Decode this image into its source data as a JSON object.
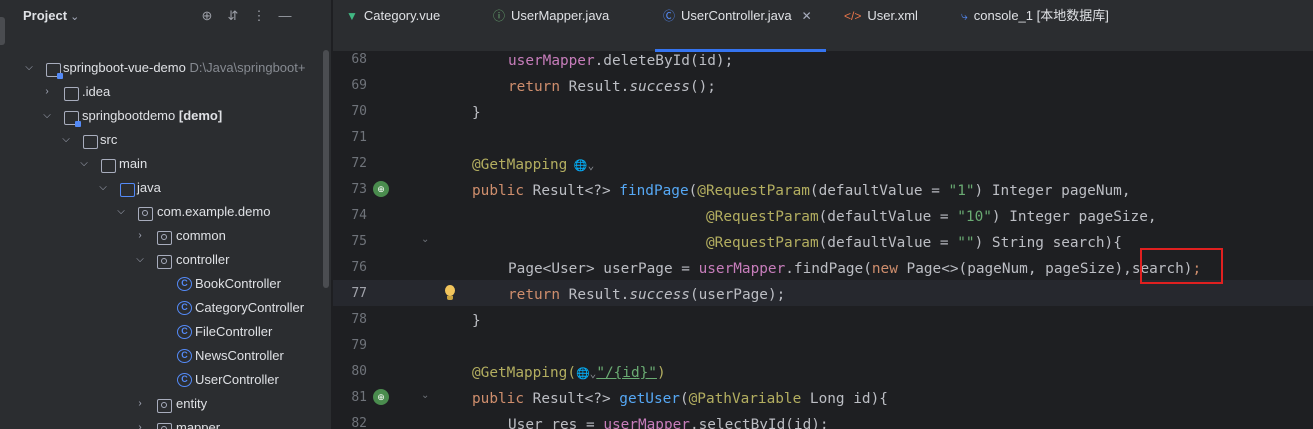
{
  "project_panel": {
    "title": "Project",
    "tree": [
      {
        "label": "springboot-vue-demo",
        "hint": "D:\\Java\\springboot+",
        "icon": "module-icon"
      },
      {
        "label": ".idea",
        "icon": "folder-icon"
      },
      {
        "label": "springbootdemo",
        "bold_suffix": "[demo]",
        "icon": "module-icon"
      },
      {
        "label": "src",
        "icon": "folder-icon"
      },
      {
        "label": "main",
        "icon": "folder-icon"
      },
      {
        "label": "java",
        "icon": "source-folder-icon"
      },
      {
        "label": "com.example.demo",
        "icon": "package-icon"
      },
      {
        "label": "common",
        "icon": "package-icon"
      },
      {
        "label": "controller",
        "icon": "package-icon"
      },
      {
        "label": "BookController",
        "icon": "class-icon"
      },
      {
        "label": "CategoryController",
        "icon": "class-icon"
      },
      {
        "label": "FileController",
        "icon": "class-icon"
      },
      {
        "label": "NewsController",
        "icon": "class-icon"
      },
      {
        "label": "UserController",
        "icon": "class-icon"
      },
      {
        "label": "entity",
        "icon": "package-icon"
      },
      {
        "label": "mapper",
        "icon": "package-icon"
      }
    ]
  },
  "tabs": [
    {
      "label": "Category.vue",
      "icon": "vue-icon"
    },
    {
      "label": "UserMapper.java",
      "icon": "interface-icon"
    },
    {
      "label": "UserController.java",
      "icon": "class-icon",
      "active": true
    },
    {
      "label": "User.xml",
      "icon": "xml-icon"
    },
    {
      "label": "console_1 [本地数据库]",
      "icon": "console-icon"
    }
  ],
  "editor": {
    "line_numbers": [
      "68",
      "69",
      "70",
      "71",
      "72",
      "73",
      "74",
      "75",
      "76",
      "77",
      "78",
      "79",
      "80",
      "81",
      "82"
    ],
    "current_line": "77",
    "lines": {
      "l68_a": "userMapper",
      "l68_b": ".deleteById(id);",
      "l69_a": "return ",
      "l69_b": "Result.",
      "l69_c": "success",
      "l69_d": "();",
      "l70": "}",
      "l72": "@GetMapping",
      "l73_a": "public ",
      "l73_b": "Result<?> ",
      "l73_c": "findPage",
      "l73_d": "(",
      "l73_e": "@RequestParam",
      "l73_f": "(defaultValue = ",
      "l73_g": "\"1\"",
      "l73_h": ") Integer pageNum,",
      "l74_e": "@RequestParam",
      "l74_f": "(defaultValue = ",
      "l74_g": "\"10\"",
      "l74_h": ") Integer pageSize,",
      "l75_e": "@RequestParam",
      "l75_f": "(defaultValue = ",
      "l75_g": "\"\"",
      "l75_h": ") String search){",
      "l76_a": "Page<User> userPage = ",
      "l76_b": "userMapper",
      "l76_c": ".findPage(",
      "l76_d": "new ",
      "l76_e": "Page<>(pageNum, pageSize)",
      "l76_f": ",search)",
      "l76_g": ";",
      "l77_a": "return ",
      "l77_b": "Result.",
      "l77_c": "success",
      "l77_d": "(userPage);",
      "l78": "}",
      "l80_a": "@GetMapping",
      "l80_b": "(",
      "l80_c": "\"/{id}\"",
      "l80_d": ")",
      "l81_a": "public ",
      "l81_b": "Result<?> ",
      "l81_c": "getUser",
      "l81_d": "(",
      "l81_e": "@PathVariable ",
      "l81_f": "Long id){",
      "l82_a": "User res = ",
      "l82_b": "userMapper",
      "l82_c": ".selectById(id);"
    }
  },
  "colors": {
    "background": "#1e1f22",
    "panel": "#2b2d30",
    "accent": "#3574f0",
    "highlight_box": "#e02020"
  }
}
